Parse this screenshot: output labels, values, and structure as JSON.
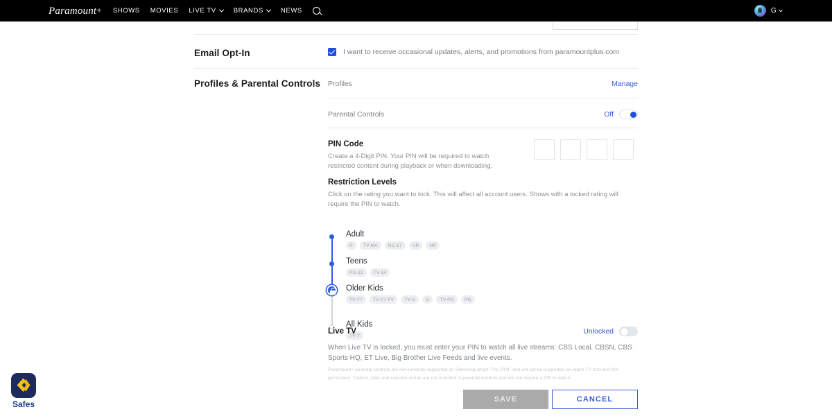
{
  "navbar": {
    "logo": "Paramount",
    "logo_plus": "+",
    "links": [
      {
        "label": "SHOWS",
        "has_chevron": false
      },
      {
        "label": "MOVIES",
        "has_chevron": false
      },
      {
        "label": "LIVE TV",
        "has_chevron": true
      },
      {
        "label": "BRANDS",
        "has_chevron": true
      },
      {
        "label": "NEWS",
        "has_chevron": false
      }
    ],
    "search_icon": "search-icon",
    "account_initial": "G"
  },
  "sections": {
    "email_optin": {
      "label": "Email Opt-In",
      "checkbox_checked": true,
      "text": "I want to receive occasional updates, alerts, and promotions from paramountplus.com"
    },
    "profiles": {
      "label": "Profiles & Parental Controls",
      "profiles_row_label": "Profiles",
      "manage_link": "Manage",
      "parental_row_label": "Parental Controls",
      "parental_toggle_state": "Off"
    },
    "pin": {
      "title": "PIN Code",
      "description": "Create a 4-Digit PIN. Your PIN will be required to watch restricted content during playback or when downloading.",
      "digits": [
        "",
        "",
        "",
        ""
      ]
    },
    "restrictions": {
      "title": "Restriction Levels",
      "description": "Click on the rating you want to lock. This will affect all account users. Shows with a locked rating will require the PIN to watch.",
      "levels": [
        {
          "name": "Adult",
          "node": "dot",
          "tags": [
            "R",
            "TV-MA",
            "NC-17",
            "UR",
            "NR"
          ]
        },
        {
          "name": "Teens",
          "node": "dot",
          "tags": [
            "PG-13",
            "TV-14"
          ]
        },
        {
          "name": "Older Kids",
          "node": "lock",
          "tags": [
            "TV-Y7",
            "TV-Y7-FV",
            "TV-G",
            "G",
            "TV-PG",
            "PG"
          ]
        },
        {
          "name": "All Kids",
          "node": "hollow",
          "tags": [
            "TV-Y"
          ]
        }
      ]
    },
    "live_tv": {
      "title": "Live TV",
      "toggle_state": "Unlocked",
      "description": "When Live TV is locked, you must enter your PIN to watch all live streams: CBS Local, CBSN, CBS Sports HQ, ET Live, Big Brother Live Feeds and live events.",
      "fine_print": "Paramount+ parental controls are not currently supported on Samsung smart TVs, PS4, and will not be supported on Apple TV 2nd and 3rd generation. Trailers, clips and episode extras are not included in parental controls and will not require a PIN to watch."
    }
  },
  "buttons": {
    "save": "SAVE",
    "cancel": "CANCEL"
  },
  "watermark": {
    "label": "Safes"
  },
  "colors": {
    "accent_blue": "#2b5ce6",
    "link_blue": "#3a5ccc",
    "navbar_black": "#000000",
    "tag_gray": "#eceef1",
    "save_disabled": "#aaaaaa"
  }
}
